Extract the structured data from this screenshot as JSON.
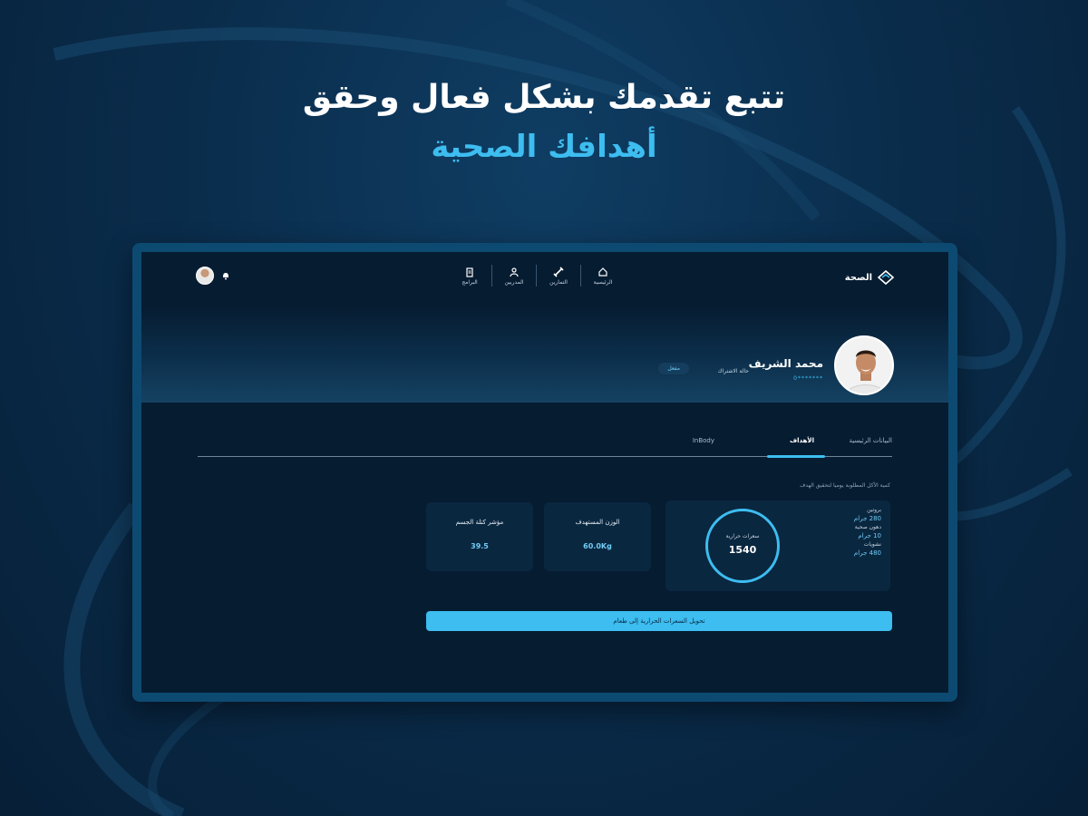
{
  "headline": {
    "line1": "تتبع تقدمك بشكل فعال وحقق",
    "line2": "أهدافك الصحية"
  },
  "app": {
    "logo_text": "الصحة",
    "nav": [
      {
        "label": "الرئيسية",
        "icon": "home-icon"
      },
      {
        "label": "التمارين",
        "icon": "dumbbell-icon"
      },
      {
        "label": "المدربين",
        "icon": "users-icon"
      },
      {
        "label": "البرامج",
        "icon": "clipboard-icon"
      }
    ],
    "profile": {
      "name": "محمد الشريف",
      "phone": "0*******",
      "subscription_label": "حالة الاشتراك",
      "subscription_status": "مفعل"
    },
    "tabs": [
      "البيانات الرئيسية",
      "الأهداف",
      "InBody"
    ],
    "active_tab": "الأهداف",
    "hint": "كمية الأكل المطلوبة يوميا لتحقيق الهدف",
    "calories": {
      "label": "سعرات حرارية",
      "value": "1540"
    },
    "macros": [
      {
        "name": "بروتين",
        "value": "280 جرام"
      },
      {
        "name": "دهون صحية",
        "value": "10 جرام"
      },
      {
        "name": "نشويات",
        "value": "480 جرام"
      }
    ],
    "stats": [
      {
        "title": "الوزن المستهدف",
        "value": "60.0Kg"
      },
      {
        "title": "مؤشر كتلة الجسم",
        "value": "39.5"
      }
    ],
    "cta_label": "تحويل السعرات الحرارية إلى طعام",
    "colors": {
      "accent": "#3dbdf0",
      "bg": "#061c31",
      "frame": "#0d4a72"
    }
  }
}
